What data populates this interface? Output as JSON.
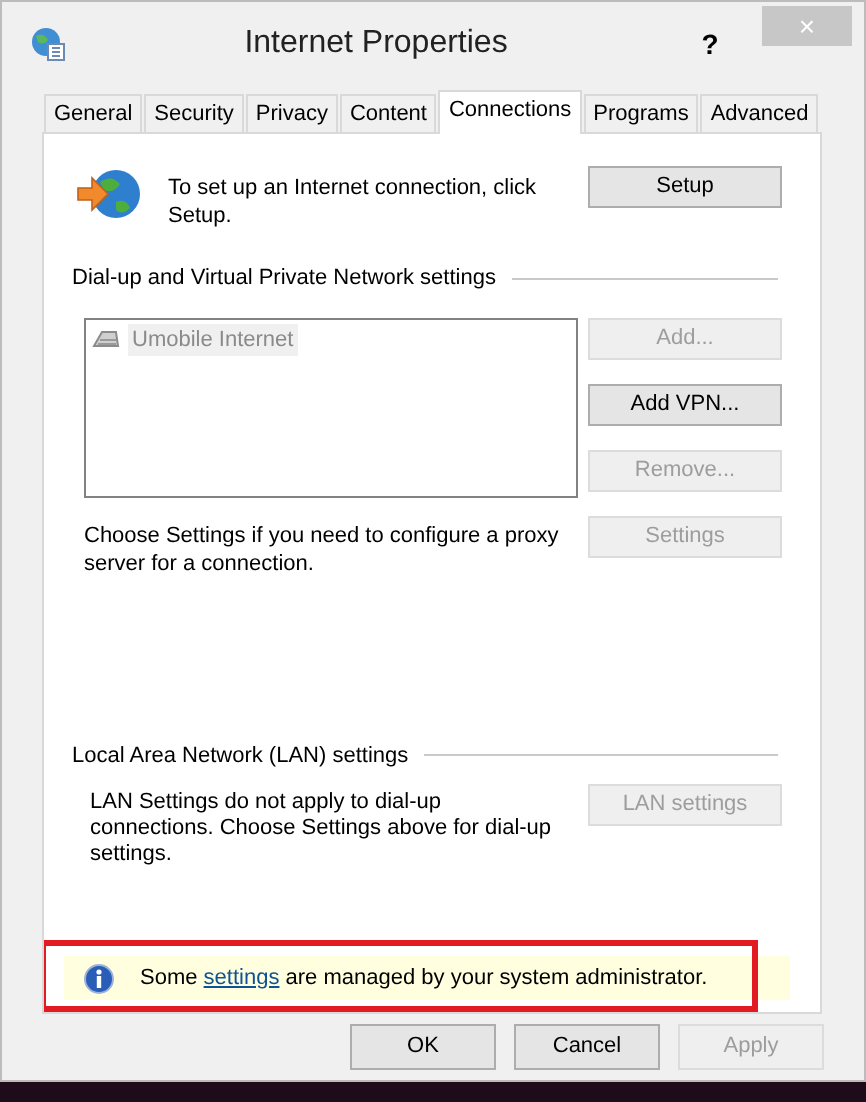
{
  "window": {
    "title": "Internet Properties",
    "help": "?",
    "close": "×"
  },
  "tabs": [
    {
      "label": "General",
      "selected": false
    },
    {
      "label": "Security",
      "selected": false
    },
    {
      "label": "Privacy",
      "selected": false
    },
    {
      "label": "Content",
      "selected": false
    },
    {
      "label": "Connections",
      "selected": true
    },
    {
      "label": "Programs",
      "selected": false
    },
    {
      "label": "Advanced",
      "selected": false
    }
  ],
  "setup": {
    "text": "To set up an Internet connection, click Setup.",
    "button": {
      "label": "Setup",
      "disabled": false
    }
  },
  "dialup": {
    "heading": "Dial-up and Virtual Private Network settings",
    "connections": [
      {
        "name": "Umobile Internet",
        "selected": true
      }
    ],
    "buttons": [
      {
        "label": "Add...",
        "disabled": true
      },
      {
        "label": "Add VPN...",
        "disabled": false
      },
      {
        "label": "Remove...",
        "disabled": true
      }
    ],
    "proxy_text": "Choose Settings if you need to configure a proxy server for a connection.",
    "settings_button": {
      "label": "Settings",
      "disabled": true
    }
  },
  "lan": {
    "heading": "Local Area Network (LAN) settings",
    "text": "LAN Settings do not apply to dial-up connections. Choose Settings above for dial-up settings.",
    "button": {
      "label": "LAN settings",
      "disabled": true
    }
  },
  "info": {
    "before": "Some",
    "link": "settings",
    "after": "are managed by your system administrator.",
    "highlighted": true
  },
  "footer_buttons": [
    {
      "label": "OK",
      "disabled": false
    },
    {
      "label": "Cancel",
      "disabled": false
    },
    {
      "label": "Apply",
      "disabled": true
    }
  ]
}
